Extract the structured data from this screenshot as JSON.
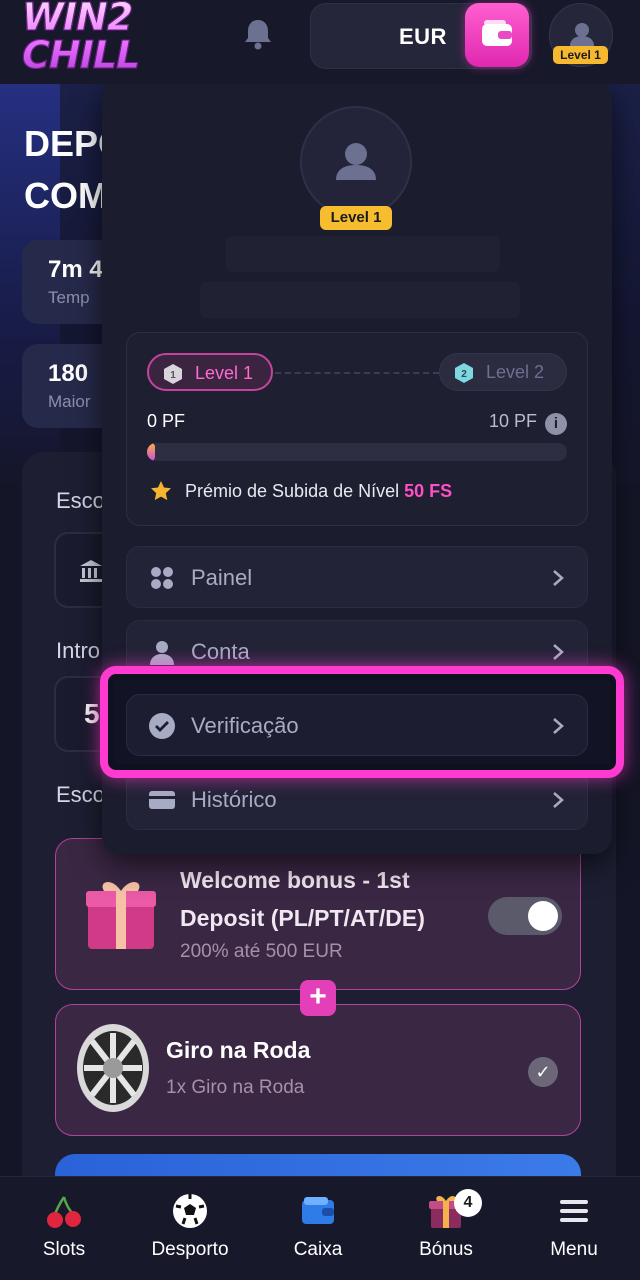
{
  "header": {
    "logo_line1": "WIN2",
    "logo_line2": "CHILL",
    "currency": "EUR",
    "level_badge": "Level 1",
    "bell_icon": "bell-icon",
    "wallet_icon": "wallet-icon"
  },
  "background": {
    "title_line1": "DEPO",
    "title_line2": "COM",
    "stat1_value": "7m 4",
    "stat1_label": "Temp",
    "stat2_value": "180",
    "stat2_label": "Maior",
    "label_method": "Esco",
    "label_amount": "Intro",
    "amount_value": "5",
    "label_bonus": "Esco",
    "welcome_bonus": {
      "title": "Welcome bonus - 1st Deposit (PL/PT/AT/DE)",
      "subtitle": "200% até 500 EUR",
      "toggle_on": true
    },
    "wheel_bonus": {
      "title": "Giro na Roda",
      "subtitle": "1x Giro na Roda",
      "checked": true
    },
    "plus_symbol": "+"
  },
  "dropdown": {
    "level_badge": "Level 1",
    "level_current": "Level 1",
    "level_current_num": "1",
    "level_next": "Level 2",
    "level_next_num": "2",
    "points_current": "0 PF",
    "points_target": "10 PF",
    "progress_fraction": 0.02,
    "info_symbol": "i",
    "prize_label": "Prémio de Subida de Nível",
    "prize_value": "50 FS",
    "items": [
      {
        "label": "Painel",
        "icon": "grid-icon"
      },
      {
        "label": "Conta",
        "icon": "user-icon"
      },
      {
        "label": "Verificação",
        "icon": "check-circle-icon"
      },
      {
        "label": "Histórico",
        "icon": "card-icon"
      }
    ]
  },
  "bottom_nav": [
    {
      "label": "Slots",
      "icon": "cherry-icon"
    },
    {
      "label": "Desporto",
      "icon": "soccer-ball-icon"
    },
    {
      "label": "Caixa",
      "icon": "wallet-icon"
    },
    {
      "label": "Bónus",
      "icon": "gift-icon",
      "badge": "4"
    },
    {
      "label": "Menu",
      "icon": "hamburger-icon"
    }
  ],
  "colors": {
    "accent_pink": "#ff3ad0",
    "level_gold": "#f6bd2e",
    "background": "#141526"
  }
}
